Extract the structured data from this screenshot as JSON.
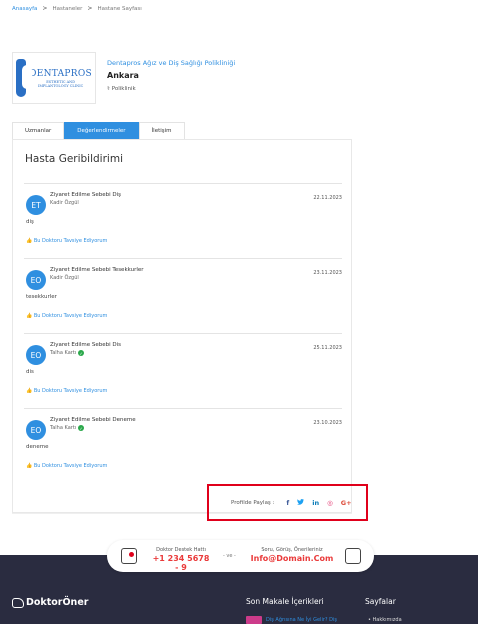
{
  "breadcrumb": {
    "items": [
      "Anasayfa",
      "Hastaneler",
      "Hastane Sayfası"
    ],
    "separator": ">"
  },
  "hospital": {
    "logo": {
      "line1": "DENTAPROS",
      "line2": "ESTHETIC AND",
      "line3": "IMPLANTOLOGY CLINIC"
    },
    "name": "Dentapros Ağız ve Diş Sağlığı Polikliniği",
    "city": "Ankara",
    "type": "Poliklinik"
  },
  "tabs": [
    {
      "label": "Uzmanlar",
      "active": false
    },
    {
      "label": "Değerlendirmeler",
      "active": true
    },
    {
      "label": "İletişim",
      "active": false
    }
  ],
  "panel_title": "Hasta Geribildirimi",
  "reviews": [
    {
      "initials": "ET",
      "title": "Ziyaret Edilme Sebebi Diş",
      "author": "Kadir Özgül",
      "verified": false,
      "date": "22.11.2023",
      "text": "diş",
      "recommend": "Bu Doktoru Tavsiye Ediyorum"
    },
    {
      "initials": "EO",
      "title": "Ziyaret Edilme Sebebi Tesekkurler",
      "author": "Kadir Özgül",
      "verified": false,
      "date": "23.11.2023",
      "text": "tesekkurler",
      "recommend": "Bu Doktoru Tavsiye Ediyorum"
    },
    {
      "initials": "EO",
      "title": "Ziyaret Edilme Sebebi Dis",
      "author": "Talha Kartı",
      "verified": true,
      "date": "25.11.2023",
      "text": "dis",
      "recommend": "Bu Doktoru Tavsiye Ediyorum"
    },
    {
      "initials": "EO",
      "title": "Ziyaret Edilme Sebebi Deneme",
      "author": "Talha Kartı",
      "verified": true,
      "date": "23.10.2023",
      "text": "deneme",
      "recommend": "Bu Doktoru Tavsiye Ediyorum"
    }
  ],
  "share": {
    "label": "Profilde Paylaş :",
    "icons": [
      {
        "name": "facebook-icon",
        "glyph": "f",
        "color": "#3b5998"
      },
      {
        "name": "twitter-icon",
        "glyph": "🐦",
        "color": "#1da1f2"
      },
      {
        "name": "linkedin-icon",
        "glyph": "in",
        "color": "#0077b5"
      },
      {
        "name": "instagram-icon",
        "glyph": "◎",
        "color": "#e1306c"
      },
      {
        "name": "google-plus-icon",
        "glyph": "G+",
        "color": "#dd4b39"
      }
    ]
  },
  "contact": {
    "support_label": "Doktor Destek Hattı",
    "support_value": "+1 234 5678 - 9",
    "vs": "- ve -",
    "mail_label": "Soru, Görüş, Önerileriniz",
    "mail_value": "Info@Domain.Com"
  },
  "footer": {
    "brand": "DoktorÖner",
    "col1_title": "Son Makale İçerikleri",
    "col1_item": "Diş Ağrısına Ne İyi Gelir? Diş",
    "col2_title": "Sayfalar",
    "col2_item": "Hakkımızda"
  },
  "colors": {
    "accent": "#2f8fe0",
    "highlight_border": "#e0001b",
    "footer_bg": "#2a2c40",
    "contact_value": "#ea3a3a"
  }
}
